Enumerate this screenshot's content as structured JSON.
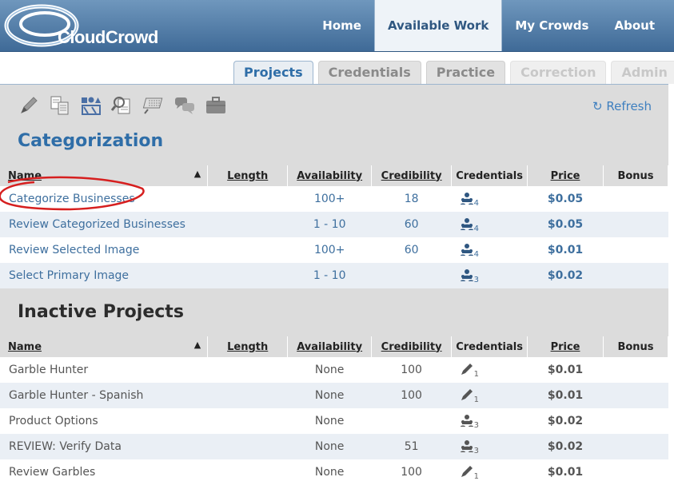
{
  "header": {
    "logo_text": "CloudCrowd",
    "nav": [
      "Home",
      "Available Work",
      "My Crowds",
      "About"
    ],
    "active_nav": "Available Work"
  },
  "tabs": [
    {
      "label": "Projects",
      "state": "active"
    },
    {
      "label": "Credentials",
      "state": "normal"
    },
    {
      "label": "Practice",
      "state": "normal"
    },
    {
      "label": "Correction",
      "state": "disabled"
    },
    {
      "label": "Admin",
      "state": "disabled"
    }
  ],
  "toolbar": {
    "icons": [
      "pencil-icon",
      "documents-icon",
      "shapes-icon",
      "search-document-icon",
      "keyboard-icon",
      "chat-icon",
      "briefcase-icon"
    ],
    "refresh_label": "Refresh"
  },
  "columns": [
    "Name",
    "Length",
    "Availability",
    "Credibility",
    "Credentials",
    "Price",
    "Bonus"
  ],
  "sections": [
    {
      "title": "Categorization",
      "rows": [
        {
          "name": "Categorize Businesses",
          "length": "",
          "availability": "100+",
          "credibility": "18",
          "cred_icon": "team-icon",
          "cred_count": "4",
          "price": "$0.05",
          "bonus": ""
        },
        {
          "name": "Review Categorized Businesses",
          "length": "",
          "availability": "1 - 10",
          "credibility": "60",
          "cred_icon": "team-icon",
          "cred_count": "4",
          "price": "$0.05",
          "bonus": ""
        },
        {
          "name": "Review Selected Image",
          "length": "",
          "availability": "100+",
          "credibility": "60",
          "cred_icon": "team-icon",
          "cred_count": "4",
          "price": "$0.01",
          "bonus": ""
        },
        {
          "name": "Select Primary Image",
          "length": "",
          "availability": "1 - 10",
          "credibility": "",
          "cred_icon": "team-icon",
          "cred_count": "3",
          "price": "$0.02",
          "bonus": ""
        }
      ]
    },
    {
      "title": "Inactive Projects",
      "rows": [
        {
          "name": "Garble Hunter",
          "length": "",
          "availability": "None",
          "credibility": "100",
          "cred_icon": "pencil-icon",
          "cred_count": "1",
          "price": "$0.01",
          "bonus": ""
        },
        {
          "name": "Garble Hunter - Spanish",
          "length": "",
          "availability": "None",
          "credibility": "100",
          "cred_icon": "pencil-icon",
          "cred_count": "1",
          "price": "$0.01",
          "bonus": ""
        },
        {
          "name": "Product Options",
          "length": "",
          "availability": "None",
          "credibility": "",
          "cred_icon": "team-icon",
          "cred_count": "3",
          "price": "$0.02",
          "bonus": ""
        },
        {
          "name": "REVIEW: Verify Data",
          "length": "",
          "availability": "None",
          "credibility": "51",
          "cred_icon": "team-icon",
          "cred_count": "3",
          "price": "$0.02",
          "bonus": ""
        },
        {
          "name": "Review Garbles",
          "length": "",
          "availability": "None",
          "credibility": "100",
          "cred_icon": "pencil-icon",
          "cred_count": "1",
          "price": "$0.01",
          "bonus": ""
        }
      ]
    }
  ]
}
